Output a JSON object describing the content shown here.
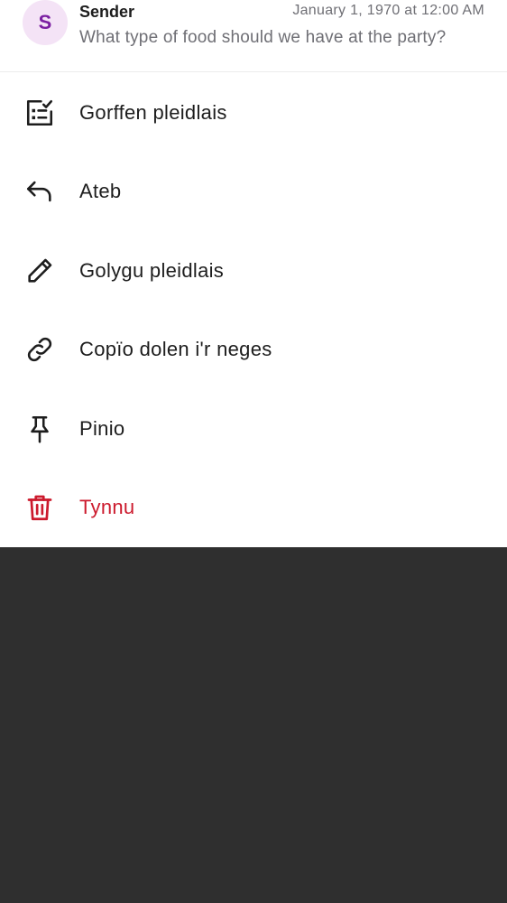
{
  "message": {
    "avatar_initial": "S",
    "sender": "Sender",
    "timestamp": "January 1, 1970 at 12:00 AM",
    "preview": "What type of food should we have at the party?"
  },
  "menu": {
    "items": [
      {
        "label": "Gorffen pleidlais",
        "icon": "poll-end-icon"
      },
      {
        "label": "Ateb",
        "icon": "reply-icon"
      },
      {
        "label": "Golygu pleidlais",
        "icon": "edit-pencil-icon"
      },
      {
        "label": "Copïo dolen i'r neges",
        "icon": "link-icon"
      },
      {
        "label": "Pinio",
        "icon": "pin-icon"
      },
      {
        "label": "Tynnu",
        "icon": "trash-icon"
      }
    ]
  },
  "colors": {
    "danger": "#cc1a2d",
    "avatar_bg": "#f4e3f6",
    "avatar_fg": "#7b1fa2",
    "backdrop": "#2f2f2f"
  }
}
